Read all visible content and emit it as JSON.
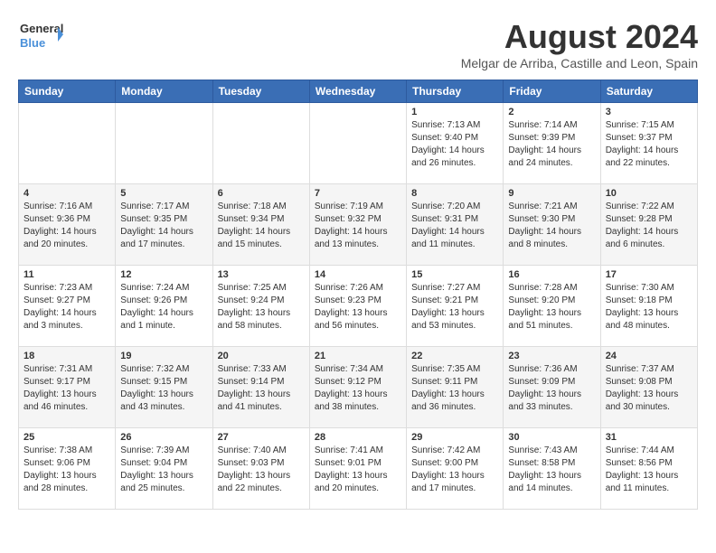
{
  "logo": {
    "line1": "General",
    "line2": "Blue"
  },
  "title": "August 2024",
  "location": "Melgar de Arriba, Castille and Leon, Spain",
  "days_of_week": [
    "Sunday",
    "Monday",
    "Tuesday",
    "Wednesday",
    "Thursday",
    "Friday",
    "Saturday"
  ],
  "weeks": [
    [
      {
        "day": "",
        "info": ""
      },
      {
        "day": "",
        "info": ""
      },
      {
        "day": "",
        "info": ""
      },
      {
        "day": "",
        "info": ""
      },
      {
        "day": "1",
        "info": "Sunrise: 7:13 AM\nSunset: 9:40 PM\nDaylight: 14 hours\nand 26 minutes."
      },
      {
        "day": "2",
        "info": "Sunrise: 7:14 AM\nSunset: 9:39 PM\nDaylight: 14 hours\nand 24 minutes."
      },
      {
        "day": "3",
        "info": "Sunrise: 7:15 AM\nSunset: 9:37 PM\nDaylight: 14 hours\nand 22 minutes."
      }
    ],
    [
      {
        "day": "4",
        "info": "Sunrise: 7:16 AM\nSunset: 9:36 PM\nDaylight: 14 hours\nand 20 minutes."
      },
      {
        "day": "5",
        "info": "Sunrise: 7:17 AM\nSunset: 9:35 PM\nDaylight: 14 hours\nand 17 minutes."
      },
      {
        "day": "6",
        "info": "Sunrise: 7:18 AM\nSunset: 9:34 PM\nDaylight: 14 hours\nand 15 minutes."
      },
      {
        "day": "7",
        "info": "Sunrise: 7:19 AM\nSunset: 9:32 PM\nDaylight: 14 hours\nand 13 minutes."
      },
      {
        "day": "8",
        "info": "Sunrise: 7:20 AM\nSunset: 9:31 PM\nDaylight: 14 hours\nand 11 minutes."
      },
      {
        "day": "9",
        "info": "Sunrise: 7:21 AM\nSunset: 9:30 PM\nDaylight: 14 hours\nand 8 minutes."
      },
      {
        "day": "10",
        "info": "Sunrise: 7:22 AM\nSunset: 9:28 PM\nDaylight: 14 hours\nand 6 minutes."
      }
    ],
    [
      {
        "day": "11",
        "info": "Sunrise: 7:23 AM\nSunset: 9:27 PM\nDaylight: 14 hours\nand 3 minutes."
      },
      {
        "day": "12",
        "info": "Sunrise: 7:24 AM\nSunset: 9:26 PM\nDaylight: 14 hours\nand 1 minute."
      },
      {
        "day": "13",
        "info": "Sunrise: 7:25 AM\nSunset: 9:24 PM\nDaylight: 13 hours\nand 58 minutes."
      },
      {
        "day": "14",
        "info": "Sunrise: 7:26 AM\nSunset: 9:23 PM\nDaylight: 13 hours\nand 56 minutes."
      },
      {
        "day": "15",
        "info": "Sunrise: 7:27 AM\nSunset: 9:21 PM\nDaylight: 13 hours\nand 53 minutes."
      },
      {
        "day": "16",
        "info": "Sunrise: 7:28 AM\nSunset: 9:20 PM\nDaylight: 13 hours\nand 51 minutes."
      },
      {
        "day": "17",
        "info": "Sunrise: 7:30 AM\nSunset: 9:18 PM\nDaylight: 13 hours\nand 48 minutes."
      }
    ],
    [
      {
        "day": "18",
        "info": "Sunrise: 7:31 AM\nSunset: 9:17 PM\nDaylight: 13 hours\nand 46 minutes."
      },
      {
        "day": "19",
        "info": "Sunrise: 7:32 AM\nSunset: 9:15 PM\nDaylight: 13 hours\nand 43 minutes."
      },
      {
        "day": "20",
        "info": "Sunrise: 7:33 AM\nSunset: 9:14 PM\nDaylight: 13 hours\nand 41 minutes."
      },
      {
        "day": "21",
        "info": "Sunrise: 7:34 AM\nSunset: 9:12 PM\nDaylight: 13 hours\nand 38 minutes."
      },
      {
        "day": "22",
        "info": "Sunrise: 7:35 AM\nSunset: 9:11 PM\nDaylight: 13 hours\nand 36 minutes."
      },
      {
        "day": "23",
        "info": "Sunrise: 7:36 AM\nSunset: 9:09 PM\nDaylight: 13 hours\nand 33 minutes."
      },
      {
        "day": "24",
        "info": "Sunrise: 7:37 AM\nSunset: 9:08 PM\nDaylight: 13 hours\nand 30 minutes."
      }
    ],
    [
      {
        "day": "25",
        "info": "Sunrise: 7:38 AM\nSunset: 9:06 PM\nDaylight: 13 hours\nand 28 minutes."
      },
      {
        "day": "26",
        "info": "Sunrise: 7:39 AM\nSunset: 9:04 PM\nDaylight: 13 hours\nand 25 minutes."
      },
      {
        "day": "27",
        "info": "Sunrise: 7:40 AM\nSunset: 9:03 PM\nDaylight: 13 hours\nand 22 minutes."
      },
      {
        "day": "28",
        "info": "Sunrise: 7:41 AM\nSunset: 9:01 PM\nDaylight: 13 hours\nand 20 minutes."
      },
      {
        "day": "29",
        "info": "Sunrise: 7:42 AM\nSunset: 9:00 PM\nDaylight: 13 hours\nand 17 minutes."
      },
      {
        "day": "30",
        "info": "Sunrise: 7:43 AM\nSunset: 8:58 PM\nDaylight: 13 hours\nand 14 minutes."
      },
      {
        "day": "31",
        "info": "Sunrise: 7:44 AM\nSunset: 8:56 PM\nDaylight: 13 hours\nand 11 minutes."
      }
    ]
  ]
}
